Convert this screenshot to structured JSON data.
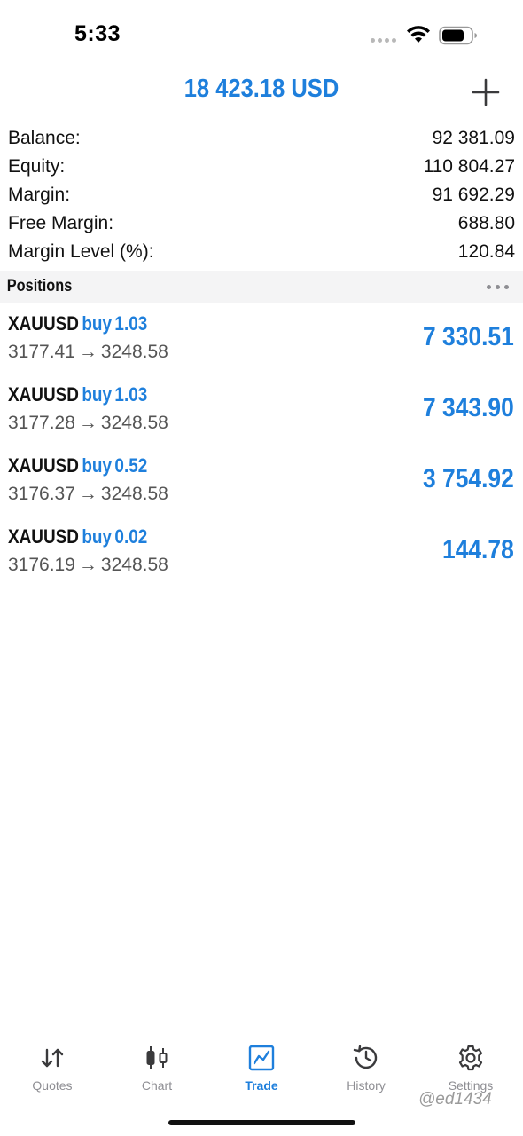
{
  "status_bar": {
    "time": "5:33"
  },
  "header": {
    "title": "18 423.18 USD",
    "add_icon": "plus-icon"
  },
  "summary": [
    {
      "label": "Balance:",
      "value": "92 381.09"
    },
    {
      "label": "Equity:",
      "value": "110 804.27"
    },
    {
      "label": "Margin:",
      "value": "91 692.29"
    },
    {
      "label": "Free Margin:",
      "value": "688.80"
    },
    {
      "label": "Margin Level (%):",
      "value": "120.84"
    }
  ],
  "positions": {
    "title": "Positions",
    "more_icon": "more-icon",
    "items": [
      {
        "symbol": "XAUUSD",
        "type": "buy",
        "volume": "1.03",
        "open_price": "3177.41",
        "arrow": "→",
        "current_price": "3248.58",
        "profit": "7 330.51"
      },
      {
        "symbol": "XAUUSD",
        "type": "buy",
        "volume": "1.03",
        "open_price": "3177.28",
        "arrow": "→",
        "current_price": "3248.58",
        "profit": "7 343.90"
      },
      {
        "symbol": "XAUUSD",
        "type": "buy",
        "volume": "0.52",
        "open_price": "3176.37",
        "arrow": "→",
        "current_price": "3248.58",
        "profit": "3 754.92"
      },
      {
        "symbol": "XAUUSD",
        "type": "buy",
        "volume": "0.02",
        "open_price": "3176.19",
        "arrow": "→",
        "current_price": "3248.58",
        "profit": "144.78"
      }
    ]
  },
  "tabs": [
    {
      "label": "Quotes",
      "icon": "quotes-icon",
      "active": false
    },
    {
      "label": "Chart",
      "icon": "chart-icon",
      "active": false
    },
    {
      "label": "Trade",
      "icon": "trade-icon",
      "active": true
    },
    {
      "label": "History",
      "icon": "history-icon",
      "active": false
    },
    {
      "label": "Settings",
      "icon": "settings-icon",
      "active": false
    }
  ],
  "watermark": "@ed1434",
  "colors": {
    "accent": "#1e7fdc",
    "text": "#111111",
    "secondary_text": "#555555",
    "inactive_tab": "#8e8e93",
    "section_bg": "#f4f4f5"
  }
}
